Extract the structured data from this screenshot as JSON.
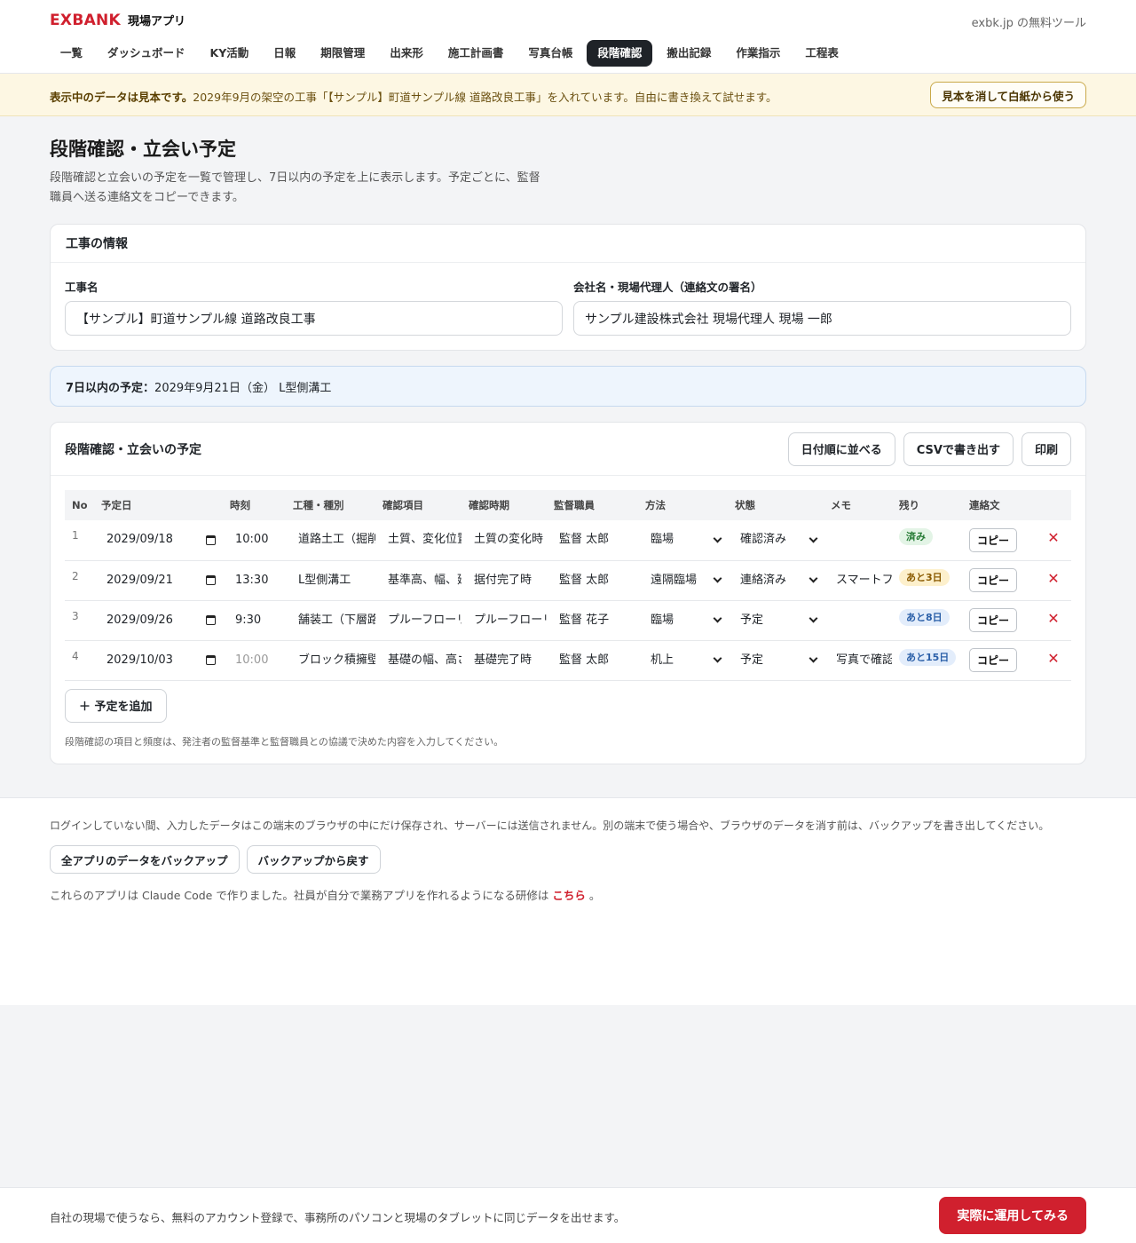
{
  "header": {
    "logo": "EXBANK",
    "app_name": "現場アプリ",
    "free_tool": "exbk.jp の無料ツール",
    "nav": [
      "一覧",
      "ダッシュボード",
      "KY活動",
      "日報",
      "期限管理",
      "出来形",
      "施工計画書",
      "写真台帳",
      "段階確認",
      "搬出記録",
      "作業指示",
      "工程表"
    ],
    "active_nav": "段階確認"
  },
  "banner": {
    "bold": "表示中のデータは見本です。",
    "text": "2029年9月の架空の工事「【サンプル】町道サンプル線 道路改良工事」を入れています。自由に書き換えて試せます。",
    "button": "見本を消して白紙から使う"
  },
  "page": {
    "title": "段階確認・立会い予定",
    "description": "段階確認と立会いの予定を一覧で管理し、7日以内の予定を上に表示します。予定ごとに、監督職員へ送る連絡文をコピーできます。"
  },
  "project": {
    "card_title": "工事の情報",
    "name_label": "工事名",
    "name_value": "【サンプル】町道サンプル線 道路改良工事",
    "company_label": "会社名・現場代理人（連絡文の署名）",
    "company_value": "サンプル建設株式会社 現場代理人 現場 一郎"
  },
  "upcoming": {
    "label": "7日以内の予定：",
    "value": "2029年9月21日（金） L型側溝工"
  },
  "schedule": {
    "title": "段階確認・立会いの予定",
    "buttons": {
      "sort": "日付順に並べる",
      "csv": "CSVで書き出す",
      "print": "印刷"
    },
    "columns": [
      "No",
      "予定日",
      "時刻",
      "工種・種別",
      "確認項目",
      "確認時期",
      "監督職員",
      "方法",
      "状態",
      "メモ",
      "残り",
      "連絡文"
    ],
    "rows": [
      {
        "no": "1",
        "date": "2029/09/18",
        "time": "10:00",
        "work": "道路土工（掘削）",
        "item": "土質、変化位置",
        "timing": "土質の変化時",
        "supervisor": "監督 太郎",
        "method": "臨場",
        "status": "確認済み",
        "memo": "",
        "remaining": "済み",
        "copy": "コピー"
      },
      {
        "no": "2",
        "date": "2029/09/21",
        "time": "13:30",
        "work": "L型側溝工",
        "item": "基準高、幅、延長",
        "timing": "据付完了時",
        "supervisor": "監督 太郎",
        "method": "遠隔臨場",
        "status": "連絡済み",
        "memo": "スマートフォン",
        "remaining": "あと3日",
        "copy": "コピー"
      },
      {
        "no": "3",
        "date": "2029/09/26",
        "time": "9:30",
        "work": "舗装工（下層路盤）",
        "item": "プルーフローリング",
        "timing": "プルーフローリング時",
        "supervisor": "監督 花子",
        "method": "臨場",
        "status": "予定",
        "memo": "",
        "remaining": "あと8日",
        "copy": "コピー"
      },
      {
        "no": "4",
        "date": "2029/10/03",
        "time": "10:00",
        "work": "ブロック積擁壁工",
        "item": "基礎の幅、高さ",
        "timing": "基礎完了時",
        "supervisor": "監督 太郎",
        "method": "机上",
        "status": "予定",
        "memo": "写真で確認",
        "remaining": "あと15日",
        "copy": "コピー"
      }
    ],
    "add_button": "＋ 予定を追加",
    "note": "段階確認の項目と頻度は、発注者の監督基準と監督職員との協議で決めた内容を入力してください。"
  },
  "footer": {
    "storage_note": "ログインしていない間、入力したデータはこの端末のブラウザの中にだけ保存され、サーバーには送信されません。別の端末で使う場合や、ブラウザのデータを消す前は、バックアップを書き出してください。",
    "backup_button": "全アプリのデータをバックアップ",
    "restore_button": "バックアップから戻す",
    "claude_note": "これらのアプリは Claude Code で作りました。社員が自分で業務アプリを作れるようになる研修は",
    "link_text": "こちら",
    "suffix": "。"
  },
  "bottom_bar": {
    "text": "自社の現場で使うなら、無料のアカウント登録で、事務所のパソコンと現場のタブレットに同じデータを出せます。",
    "button": "実際に運用してみる"
  },
  "colors": {
    "brand_red": "#d0202e",
    "banner_bg": "#fdf7e3",
    "notice_bg": "#eef5fd",
    "active_nav": "#1f2328"
  }
}
